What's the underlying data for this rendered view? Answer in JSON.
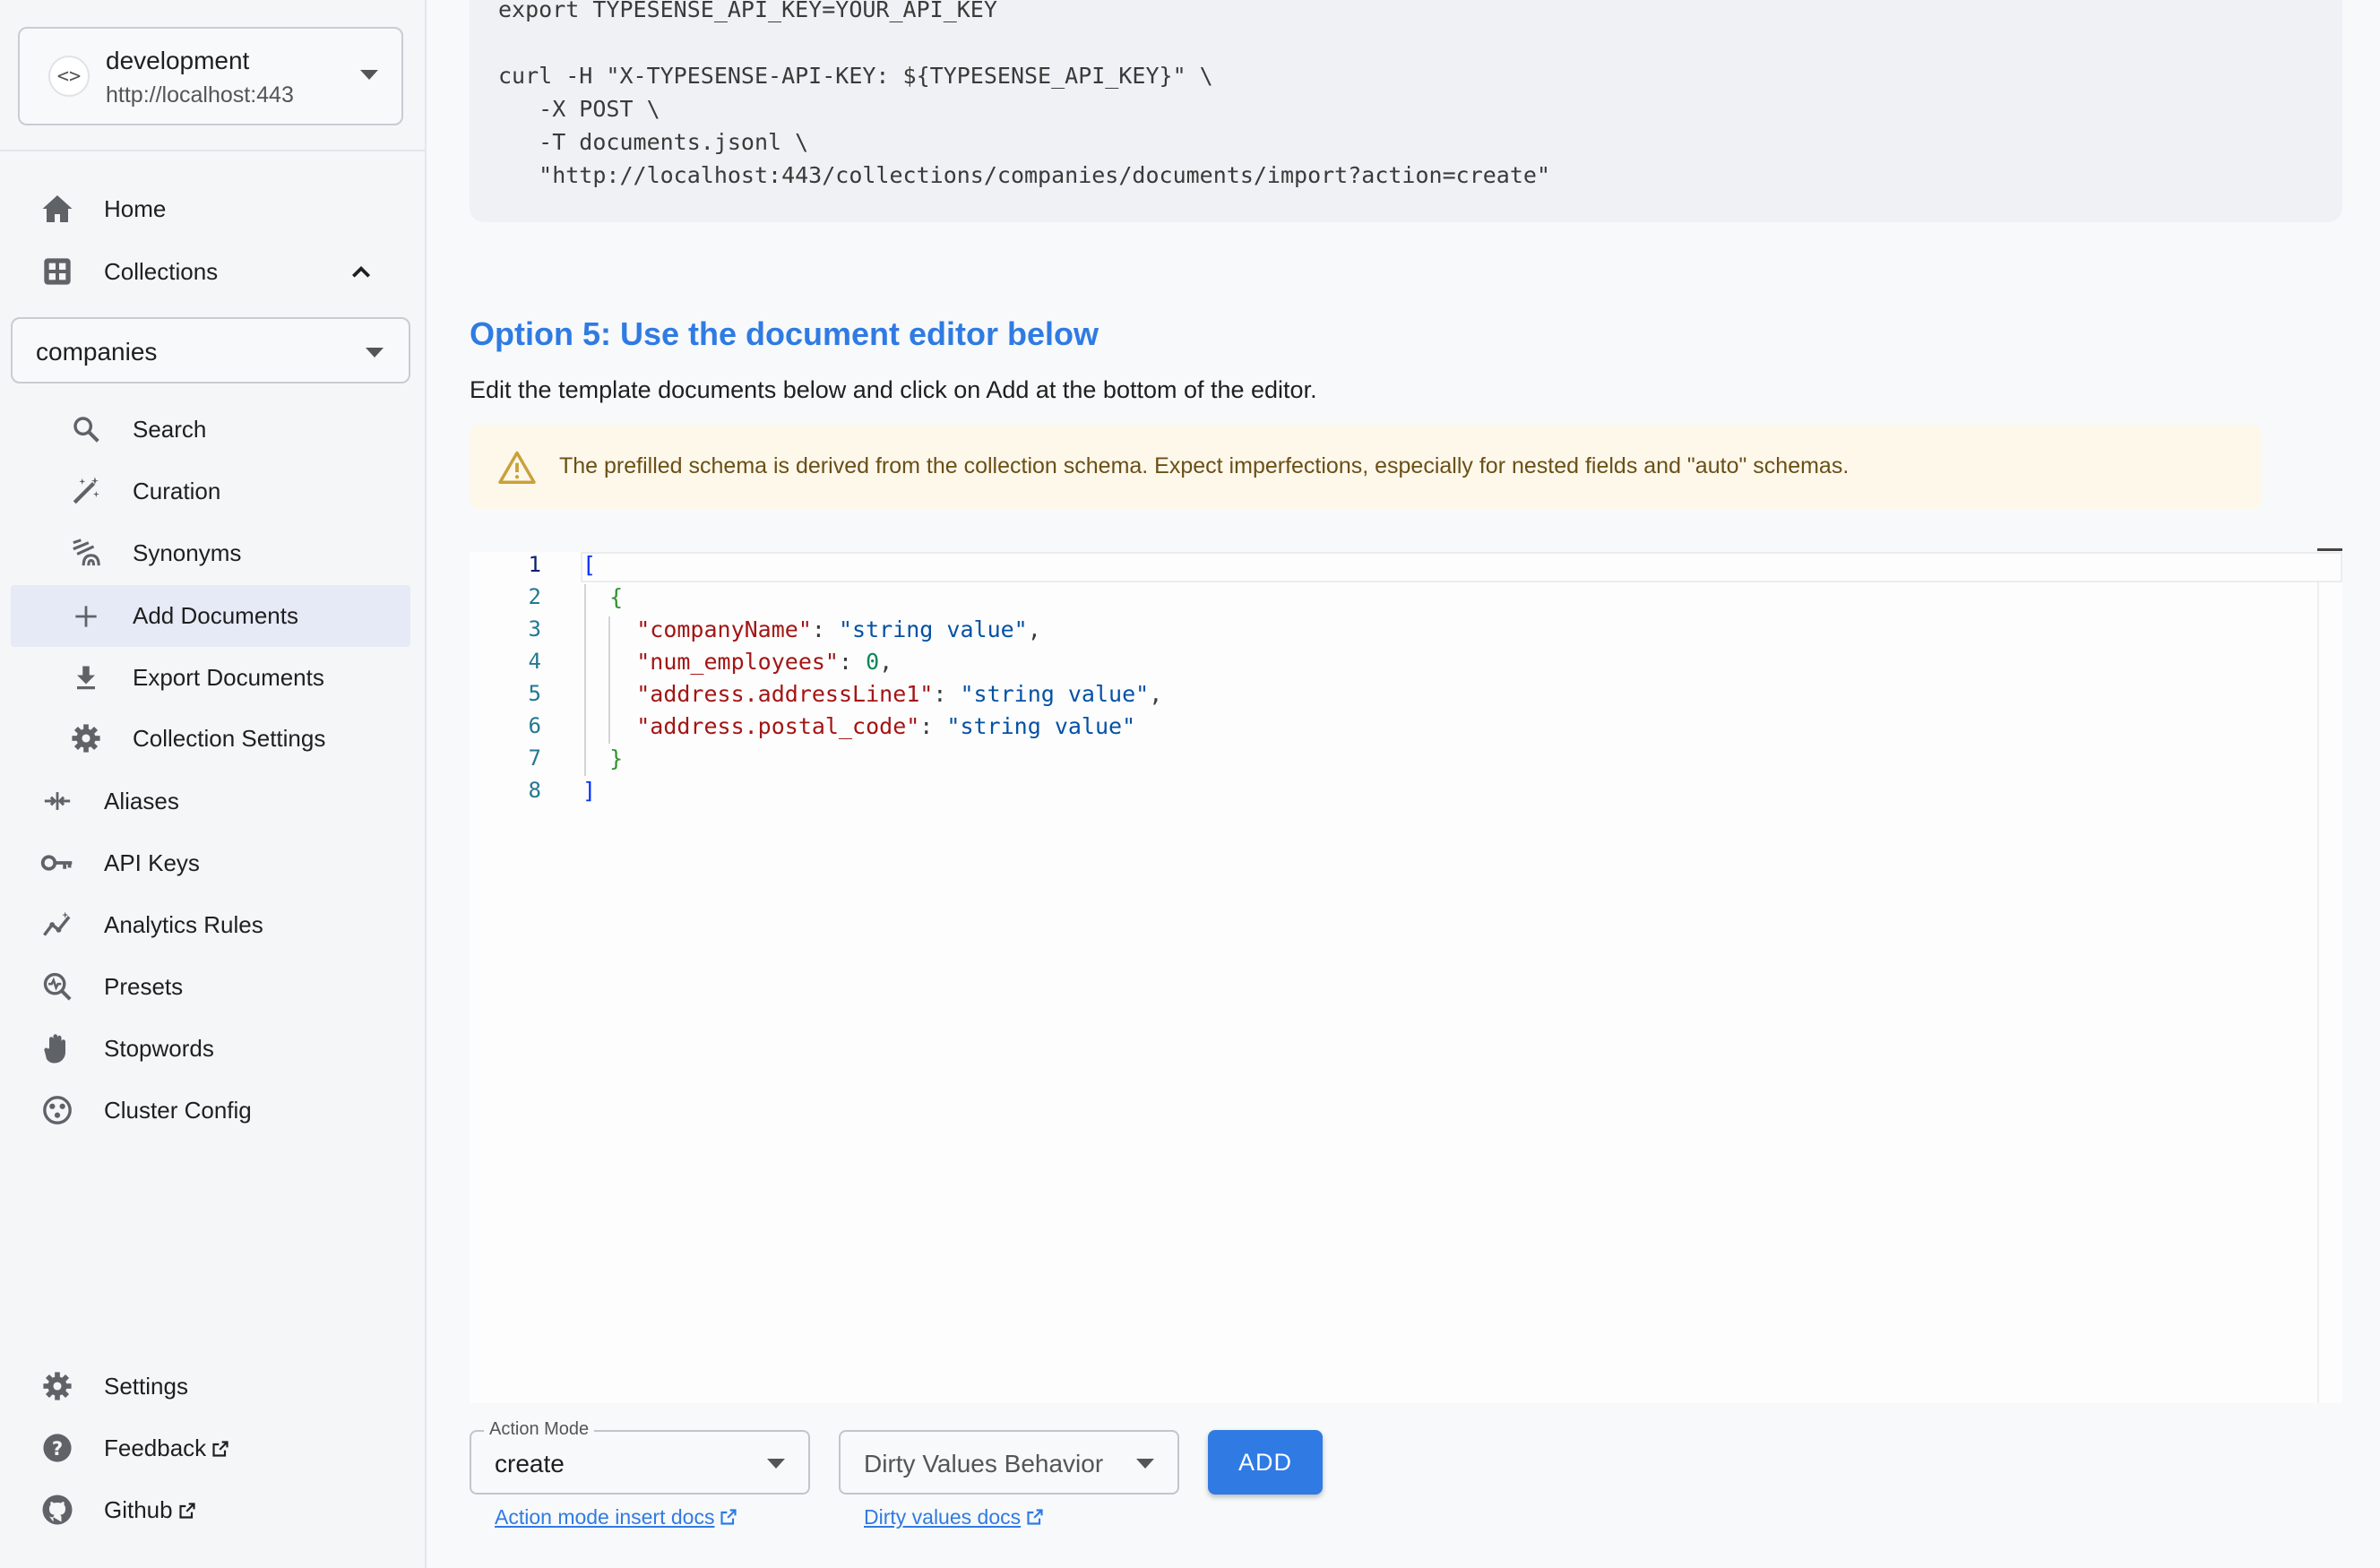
{
  "server": {
    "name": "development",
    "url": "http://localhost:443"
  },
  "nav": {
    "home": "Home",
    "collections": "Collections",
    "collection_selected": "companies",
    "sub": {
      "search": "Search",
      "curation": "Curation",
      "synonyms": "Synonyms",
      "add_documents": "Add Documents",
      "export_documents": "Export Documents",
      "collection_settings": "Collection Settings"
    },
    "aliases": "Aliases",
    "api_keys": "API Keys",
    "analytics_rules": "Analytics Rules",
    "presets": "Presets",
    "stopwords": "Stopwords",
    "cluster_config": "Cluster Config",
    "settings": "Settings",
    "feedback": "Feedback",
    "github": "Github"
  },
  "code_block": {
    "lines": [
      "export TYPESENSE_API_KEY=YOUR_API_KEY",
      "",
      "curl -H \"X-TYPESENSE-API-KEY: ${TYPESENSE_API_KEY}\" \\",
      "   -X POST \\",
      "   -T documents.jsonl \\",
      "   \"http://localhost:443/collections/companies/documents/import?action=create\""
    ]
  },
  "option5": {
    "title": "Option 5: Use the document editor below",
    "description": "Edit the template documents below and click on Add at the bottom of the editor.",
    "warning": "The prefilled schema is derived from the collection schema. Expect imperfections, especially for nested fields and \"auto\" schemas."
  },
  "editor": {
    "line_numbers": [
      "1",
      "2",
      "3",
      "4",
      "5",
      "6",
      "7",
      "8"
    ],
    "line1": "[",
    "line2": "{",
    "line3_key": "\"companyName\"",
    "line3_val": "\"string value\"",
    "line4_key": "\"num_employees\"",
    "line4_val": "0",
    "line5_key": "\"address.addressLine1\"",
    "line5_val": "\"string value\"",
    "line6_key": "\"address.postal_code\"",
    "line6_val": "\"string value\"",
    "line7": "}",
    "line8": "]"
  },
  "form": {
    "action_mode_label": "Action Mode",
    "action_mode_value": "create",
    "dirty_values_placeholder": "Dirty Values Behavior",
    "add_button": "ADD",
    "action_mode_docs": "Action mode insert docs",
    "dirty_values_docs": "Dirty values docs"
  },
  "colors": {
    "accent": "#2f7be3",
    "active_bg": "#e6eaf6",
    "warning_bg": "#fdf8ea"
  }
}
